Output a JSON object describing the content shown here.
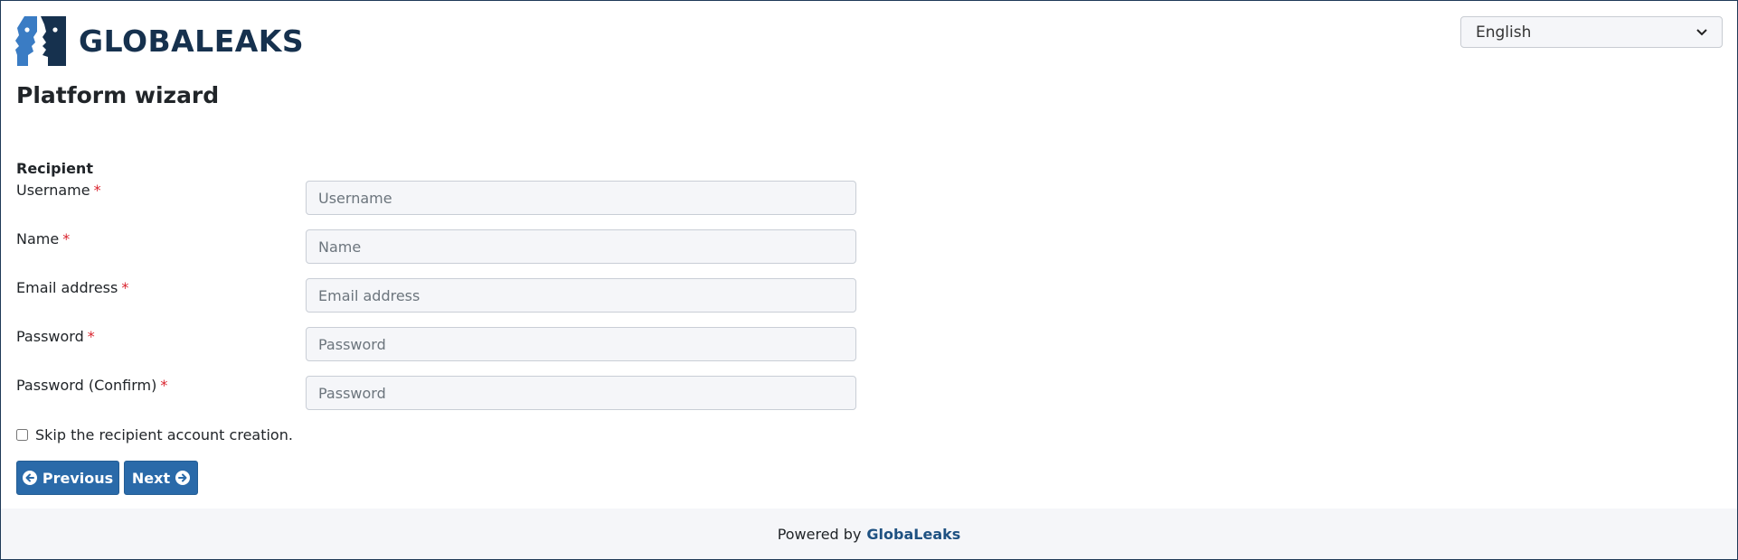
{
  "header": {
    "brand_name": "GLOBALEAKS",
    "language": {
      "selected": "English"
    }
  },
  "page": {
    "title": "Platform wizard"
  },
  "form": {
    "section_title": "Recipient",
    "required_marker": "*",
    "fields": [
      {
        "label": "Username",
        "placeholder": "Username",
        "value": ""
      },
      {
        "label": "Name",
        "placeholder": "Name",
        "value": ""
      },
      {
        "label": "Email address",
        "placeholder": "Email address",
        "value": ""
      },
      {
        "label": "Password",
        "placeholder": "Password",
        "value": ""
      },
      {
        "label": "Password (Confirm)",
        "placeholder": "Password",
        "value": ""
      }
    ],
    "skip_checkbox": {
      "label": "Skip the recipient account creation.",
      "checked": false
    }
  },
  "actions": {
    "previous_label": "Previous",
    "next_label": "Next"
  },
  "footer": {
    "powered_by": "Powered by",
    "brand_link": "GlobaLeaks"
  },
  "colors": {
    "brand_dark": "#16314e",
    "brand_blue": "#2a6aa9",
    "required": "#d9232d",
    "footer_bg": "#f5f6f9"
  },
  "icons": {
    "logo": "globaleaks-faces-logo",
    "previous": "arrow-circle-left-icon",
    "next": "arrow-circle-right-icon",
    "select": "chevron-down-icon"
  }
}
